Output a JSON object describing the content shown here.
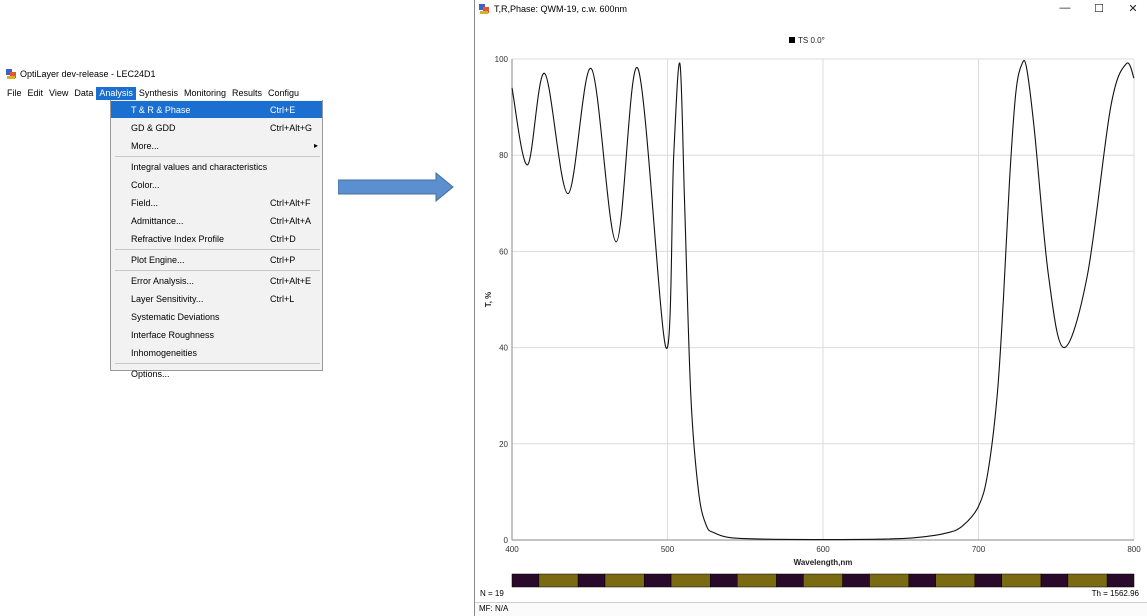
{
  "app": {
    "title": "OptiLayer dev-release - LEC24D1"
  },
  "menubar": [
    {
      "label": "File",
      "active": false
    },
    {
      "label": "Edit",
      "active": false
    },
    {
      "label": "View",
      "active": false
    },
    {
      "label": "Data",
      "active": false
    },
    {
      "label": "Analysis",
      "active": true
    },
    {
      "label": "Synthesis",
      "active": false
    },
    {
      "label": "Monitoring",
      "active": false
    },
    {
      "label": "Results",
      "active": false
    },
    {
      "label": "Configu",
      "active": false
    }
  ],
  "analysis_menu": [
    {
      "label": "T & R & Phase",
      "shortcut": "Ctrl+E",
      "selected": true
    },
    {
      "label": "GD & GDD",
      "shortcut": "Ctrl+Alt+G"
    },
    {
      "label": "More...",
      "shortcut": "",
      "submenu": true
    },
    {
      "separator": true
    },
    {
      "label": "Integral values and characteristics",
      "shortcut": ""
    },
    {
      "label": "Color...",
      "shortcut": ""
    },
    {
      "label": "Field...",
      "shortcut": "Ctrl+Alt+F"
    },
    {
      "label": "Admittance...",
      "shortcut": "Ctrl+Alt+A"
    },
    {
      "label": "Refractive Index Profile",
      "shortcut": "Ctrl+D"
    },
    {
      "separator": true
    },
    {
      "label": "Plot Engine...",
      "shortcut": "Ctrl+P"
    },
    {
      "separator": true
    },
    {
      "label": "Error Analysis...",
      "shortcut": "Ctrl+Alt+E"
    },
    {
      "label": "Layer Sensitivity...",
      "shortcut": "Ctrl+L"
    },
    {
      "label": "Systematic Deviations",
      "shortcut": ""
    },
    {
      "label": "Interface Roughness",
      "shortcut": ""
    },
    {
      "label": "Inhomogeneities",
      "shortcut": ""
    },
    {
      "separator": true
    },
    {
      "label": "Options...",
      "shortcut": ""
    }
  ],
  "plot_window": {
    "title": "T,R,Phase: QWM-19, c.w. 600nm",
    "controls": {
      "minimize": "—",
      "maximize": "☐",
      "close": "✕"
    },
    "status": {
      "n": "N = 19",
      "th": "Th = 1562.96",
      "mf": "MF: N/A"
    }
  },
  "colors": {
    "menu_highlight": "#1a6fd1",
    "arrow": "#5b8fd0",
    "layer_high": "#7a6a12",
    "layer_low": "#2a0a2a"
  },
  "chart_data": {
    "type": "line",
    "xlabel": "Wavelength,nm",
    "ylabel": "T, %",
    "xlim": [
      400,
      800
    ],
    "ylim": [
      0,
      100
    ],
    "xticks": [
      400,
      500,
      600,
      700,
      800
    ],
    "yticks": [
      0,
      20,
      40,
      60,
      80,
      100
    ],
    "grid": true,
    "legend": "top-center",
    "series": [
      {
        "name": "TS 0.0°",
        "x": [
          400,
          410,
          421,
          436,
          451,
          467,
          481,
          499,
          504,
          508,
          511,
          515,
          520,
          525,
          530,
          540,
          560,
          600,
          640,
          660,
          680,
          690,
          700,
          706,
          712,
          716,
          720,
          724,
          728,
          731,
          736,
          745,
          755,
          770,
          785,
          795,
          800
        ],
        "y": [
          94,
          78,
          97,
          72,
          98,
          62,
          98,
          40,
          80,
          99,
          70,
          30,
          10,
          3,
          1.5,
          0.5,
          0.2,
          0.1,
          0.2,
          0.5,
          1.5,
          3,
          7,
          14,
          30,
          50,
          75,
          93,
          99,
          98,
          85,
          55,
          40,
          55,
          90,
          99,
          96
        ]
      }
    ]
  },
  "layer_bar": {
    "pattern": [
      "L",
      "H",
      "L",
      "H",
      "L",
      "H",
      "L",
      "H",
      "L",
      "H",
      "L",
      "H",
      "L",
      "H",
      "L",
      "H",
      "L",
      "H",
      "L"
    ]
  }
}
